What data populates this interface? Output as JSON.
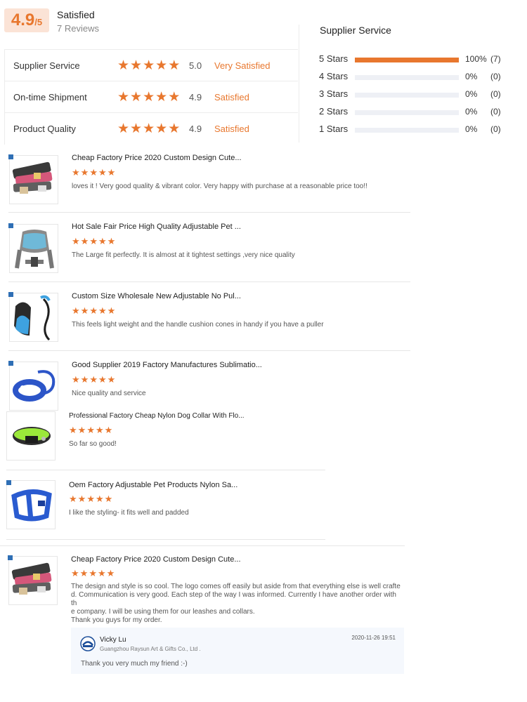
{
  "summary": {
    "score": "4.9",
    "max": "/5",
    "title": "Satisfied",
    "count": "7 Reviews"
  },
  "categories": [
    {
      "name": "Supplier Service",
      "stars": 5,
      "score": "5.0",
      "label": "Very Satisfied"
    },
    {
      "name": "On-time Shipment",
      "stars": 5,
      "score": "4.9",
      "label": "Satisfied"
    },
    {
      "name": "Product Quality",
      "stars": 5,
      "score": "4.9",
      "label": "Satisfied"
    }
  ],
  "distribution": {
    "title": "Supplier Service",
    "rows": [
      {
        "label": "5 Stars",
        "fraction": 1,
        "pct": "100%",
        "count": "(7)"
      },
      {
        "label": "4 Stars",
        "fraction": 0,
        "pct": "0%",
        "count": "(0)"
      },
      {
        "label": "3 Stars",
        "fraction": 0,
        "pct": "0%",
        "count": "(0)"
      },
      {
        "label": "2 Stars",
        "fraction": 0,
        "pct": "0%",
        "count": "(0)"
      },
      {
        "label": "1 Stars",
        "fraction": 0,
        "pct": "0%",
        "count": "(0)"
      }
    ]
  },
  "reviews": [
    {
      "title": "Cheap Factory Price 2020 Custom Design Cute...",
      "stars": 5,
      "text": "loves it ! Very good quality & vibrant color. Very happy with purchase at a reasonable price too!!",
      "thumb": "collars"
    },
    {
      "title": "Hot Sale Fair Price High Quality Adjustable Pet ...",
      "stars": 5,
      "text": "The Large fit perfectly. It is almost at it tightest settings ,very nice quality",
      "thumb": "harness-gray"
    },
    {
      "title": "Custom Size Wholesale New Adjustable No Pul...",
      "stars": 5,
      "text": "This feels light weight and the handle cushion cones in handy if you have a puller",
      "thumb": "harness-blue-leash"
    },
    {
      "title": "Good Supplier 2019 Factory Manufactures Sublimatio...",
      "stars": 5,
      "text": "Nice quality and service",
      "thumb": "collar-blue-leash"
    },
    {
      "title": "Professional Factory Cheap Nylon Dog Collar With Flo...",
      "stars": 5,
      "text": "So far so good!",
      "thumb": "collar-green"
    },
    {
      "title": "Oem Factory Adjustable Pet Products Nylon Sa...",
      "stars": 5,
      "text": "I like the styling- it fits well and padded",
      "thumb": "harness-blue"
    },
    {
      "title": "Cheap Factory Price 2020 Custom Design Cute...",
      "stars": 5,
      "text_lines": [
        "The design and style is so cool. The logo comes off easily but aside from that everything else is well crafte",
        "d. Communication is very good. Each step of the way I was informed. Currently  I have another order with th",
        "e company. I will be using them for our leashes and collars.",
        "Thank you guys for my order."
      ],
      "thumb": "collars"
    }
  ],
  "reply": {
    "name": "Vicky Lu",
    "company": "Guangzhou Raysun Art & Gifts Co., Ltd .",
    "date": "2020-11-26 19:51",
    "message": "Thank you very much my friend :-)"
  },
  "colors": {
    "accent": "#e8772e",
    "accent_bg": "#fbe3d6",
    "divider": "#e6e6e6",
    "reply_bg": "#f5f8fd"
  }
}
